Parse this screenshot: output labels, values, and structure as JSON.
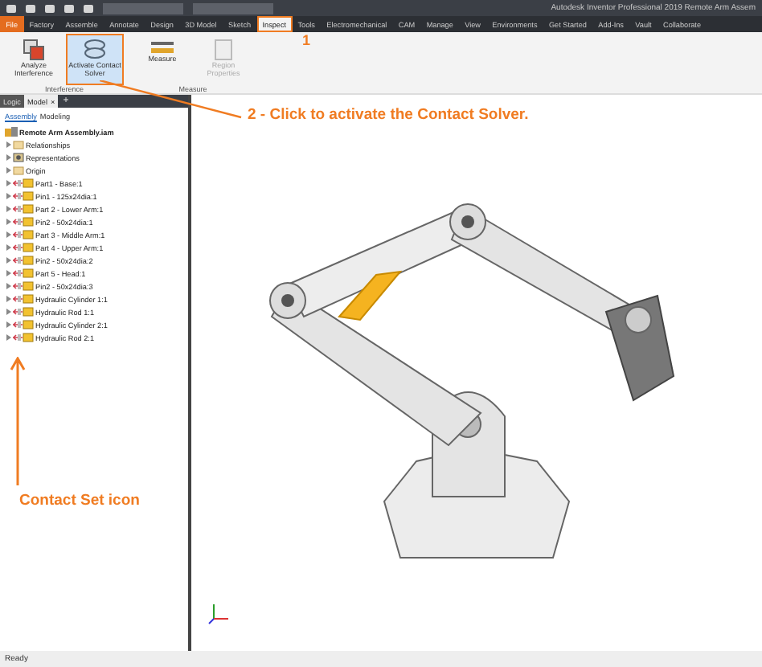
{
  "window": {
    "title": "Autodesk Inventor Professional 2019   Remote Arm Assem"
  },
  "tabs": [
    {
      "label": "File",
      "selected": false,
      "kind": "file"
    },
    {
      "label": "Factory",
      "selected": false,
      "kind": "tab"
    },
    {
      "label": "Assemble",
      "selected": false,
      "kind": "tab"
    },
    {
      "label": "Annotate",
      "selected": false,
      "kind": "tab"
    },
    {
      "label": "Design",
      "selected": false,
      "kind": "tab"
    },
    {
      "label": "3D Model",
      "selected": false,
      "kind": "tab"
    },
    {
      "label": "Sketch",
      "selected": false,
      "kind": "tab"
    },
    {
      "label": "Inspect",
      "selected": true,
      "kind": "tab"
    },
    {
      "label": "Tools",
      "selected": false,
      "kind": "tab"
    },
    {
      "label": "Electromechanical",
      "selected": false,
      "kind": "tab"
    },
    {
      "label": "CAM",
      "selected": false,
      "kind": "tab"
    },
    {
      "label": "Manage",
      "selected": false,
      "kind": "tab"
    },
    {
      "label": "View",
      "selected": false,
      "kind": "tab"
    },
    {
      "label": "Environments",
      "selected": false,
      "kind": "tab"
    },
    {
      "label": "Get Started",
      "selected": false,
      "kind": "tab"
    },
    {
      "label": "Add-Ins",
      "selected": false,
      "kind": "tab"
    },
    {
      "label": "Vault",
      "selected": false,
      "kind": "tab"
    },
    {
      "label": "Collaborate",
      "selected": false,
      "kind": "tab"
    }
  ],
  "ribbon": {
    "groups": [
      {
        "label": "Interference",
        "buttons": [
          {
            "label": "Analyze Interference",
            "kind": "interference",
            "selected": false,
            "disabled": false
          },
          {
            "label": "Activate Contact Solver",
            "kind": "contact",
            "selected": true,
            "disabled": false
          }
        ]
      },
      {
        "label": "Measure",
        "buttons": [
          {
            "label": "Measure",
            "kind": "measure",
            "selected": false,
            "disabled": false
          },
          {
            "label": "Region Properties",
            "kind": "region",
            "selected": false,
            "disabled": true
          }
        ]
      }
    ]
  },
  "browser": {
    "tabs": [
      {
        "label": "Logic",
        "selected": false
      },
      {
        "label": "Model",
        "selected": true
      }
    ],
    "add": "+",
    "close": "×",
    "modes": [
      {
        "label": "Assembly",
        "selected": true
      },
      {
        "label": "Modeling",
        "selected": false
      }
    ],
    "root": "Remote Arm Assembly.iam",
    "items": [
      {
        "label": "Relationships",
        "kind": "folder"
      },
      {
        "label": "Representations",
        "kind": "rep"
      },
      {
        "label": "Origin",
        "kind": "folder"
      },
      {
        "label": "Part1 - Base:1",
        "kind": "part"
      },
      {
        "label": "Pin1 - 125x24dia:1",
        "kind": "part"
      },
      {
        "label": "Part 2 - Lower Arm:1",
        "kind": "part"
      },
      {
        "label": "Pin2 - 50x24dia:1",
        "kind": "part"
      },
      {
        "label": "Part 3 - Middle Arm:1",
        "kind": "part"
      },
      {
        "label": "Part 4 - Upper Arm:1",
        "kind": "part"
      },
      {
        "label": "Pin2 - 50x24dia:2",
        "kind": "part"
      },
      {
        "label": "Part 5 - Head:1",
        "kind": "part"
      },
      {
        "label": "Pin2 - 50x24dia:3",
        "kind": "part"
      },
      {
        "label": "Hydraulic Cylinder 1:1",
        "kind": "part"
      },
      {
        "label": "Hydraulic Rod 1:1",
        "kind": "part"
      },
      {
        "label": "Hydraulic Cylinder 2:1",
        "kind": "part"
      },
      {
        "label": "Hydraulic Rod 2:1",
        "kind": "part"
      }
    ]
  },
  "annotations": {
    "step1": "1",
    "step2": "2 - Click to activate the Contact Solver.",
    "contact_set": "Contact Set icon"
  },
  "status_bar": "Ready"
}
